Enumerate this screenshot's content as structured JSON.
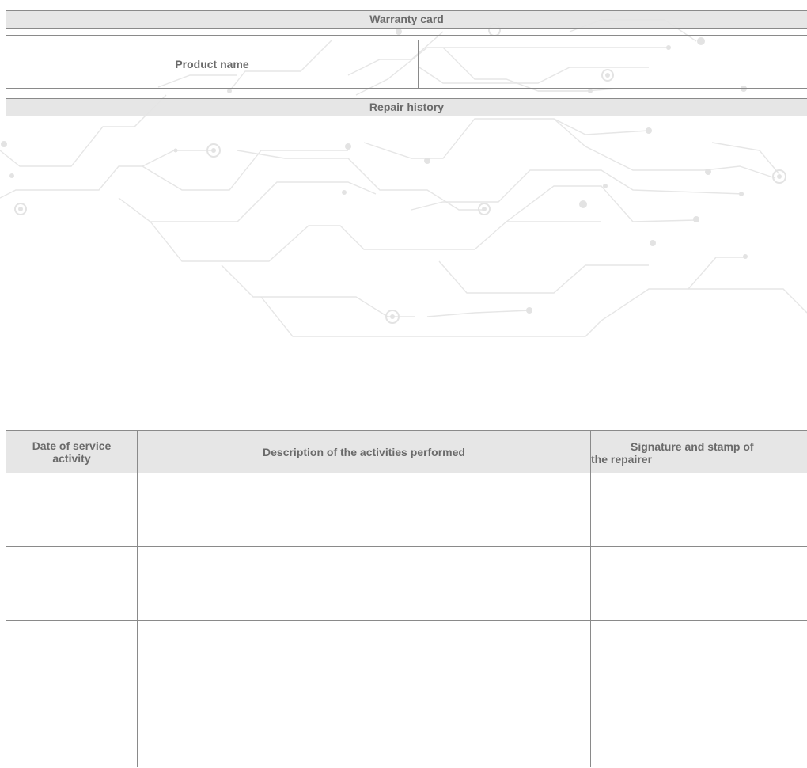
{
  "header": {
    "title": "Warranty card"
  },
  "product": {
    "label": "Product name",
    "value": ""
  },
  "repair_history": {
    "title": "Repair history"
  },
  "table": {
    "columns": [
      "Date of service activity",
      "Description of the activities performed",
      "Signature and stamp of the repairer"
    ],
    "column_lines": {
      "date": [
        "Date of service",
        "activity"
      ],
      "signature": [
        "Signature and stamp of",
        "the repairer"
      ]
    },
    "rows": [
      {
        "date": "",
        "description": "",
        "signature": ""
      },
      {
        "date": "",
        "description": "",
        "signature": ""
      },
      {
        "date": "",
        "description": "",
        "signature": ""
      },
      {
        "date": "",
        "description": "",
        "signature": ""
      }
    ]
  }
}
